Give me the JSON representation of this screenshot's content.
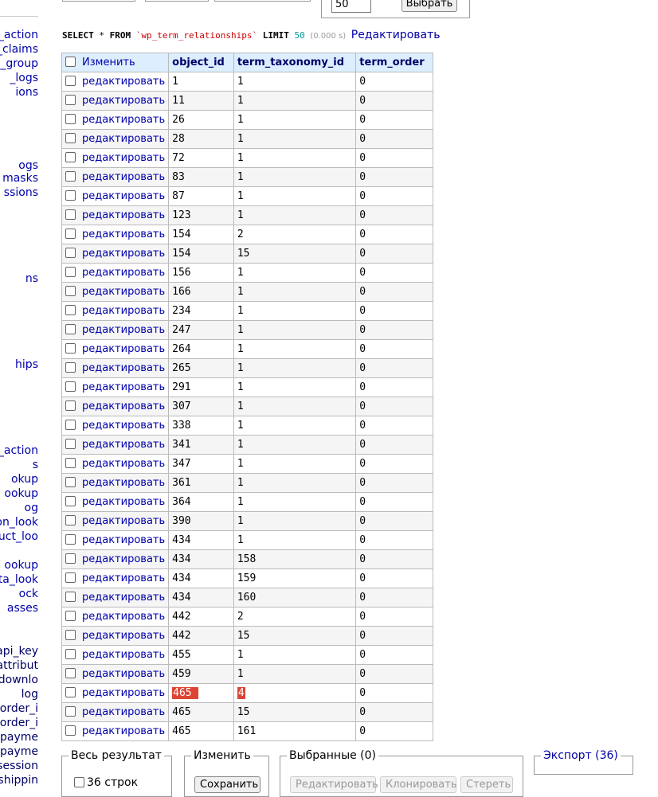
{
  "sidebar": {
    "items": [
      "_action",
      "_claims",
      "_group",
      "_logs",
      "ions",
      "ogs",
      "masks",
      "ssions",
      "ns",
      "hips",
      "_action",
      "s",
      "okup",
      "ookup",
      "og",
      "on_look",
      "uct_loo",
      "ookup",
      "ta_look",
      "ock",
      "asses",
      "api_key",
      "attribut",
      "downlo",
      "log",
      "order_i",
      "order_i",
      "payme",
      "payme",
      "session",
      "shippin"
    ]
  },
  "limit": {
    "value": "50",
    "button": "Выбрать"
  },
  "query": {
    "select": "SELECT",
    "star": "*",
    "from": "FROM",
    "table": "`wp_term_relationships`",
    "limit_kw": "LIMIT",
    "limit_num": "50",
    "time": "(0.000 s)",
    "edit_link": "Редактировать"
  },
  "table": {
    "headers": [
      "Изменить",
      "object_id",
      "term_taxonomy_id",
      "term_order"
    ],
    "edit_label": "редактировать",
    "rows": [
      [
        "1",
        "1",
        "0"
      ],
      [
        "11",
        "1",
        "0"
      ],
      [
        "26",
        "1",
        "0"
      ],
      [
        "28",
        "1",
        "0"
      ],
      [
        "72",
        "1",
        "0"
      ],
      [
        "83",
        "1",
        "0"
      ],
      [
        "87",
        "1",
        "0"
      ],
      [
        "123",
        "1",
        "0"
      ],
      [
        "154",
        "2",
        "0"
      ],
      [
        "154",
        "15",
        "0"
      ],
      [
        "156",
        "1",
        "0"
      ],
      [
        "166",
        "1",
        "0"
      ],
      [
        "234",
        "1",
        "0"
      ],
      [
        "247",
        "1",
        "0"
      ],
      [
        "264",
        "1",
        "0"
      ],
      [
        "265",
        "1",
        "0"
      ],
      [
        "291",
        "1",
        "0"
      ],
      [
        "307",
        "1",
        "0"
      ],
      [
        "338",
        "1",
        "0"
      ],
      [
        "341",
        "1",
        "0"
      ],
      [
        "347",
        "1",
        "0"
      ],
      [
        "361",
        "1",
        "0"
      ],
      [
        "364",
        "1",
        "0"
      ],
      [
        "390",
        "1",
        "0"
      ],
      [
        "434",
        "1",
        "0"
      ],
      [
        "434",
        "158",
        "0"
      ],
      [
        "434",
        "159",
        "0"
      ],
      [
        "434",
        "160",
        "0"
      ],
      [
        "442",
        "2",
        "0"
      ],
      [
        "442",
        "15",
        "0"
      ],
      [
        "455",
        "1",
        "0"
      ],
      [
        "459",
        "1",
        "0"
      ],
      [
        "465",
        "4",
        "0"
      ],
      [
        "465",
        "15",
        "0"
      ],
      [
        "465",
        "161",
        "0"
      ]
    ],
    "highlight_row": 32
  },
  "footer": {
    "whole_result": {
      "legend": "Весь результат",
      "rows_label": "36 строк"
    },
    "modify": {
      "legend": "Изменить",
      "save": "Сохранить"
    },
    "selected": {
      "legend": "Выбранные (0)",
      "edit": "Редактировать",
      "clone": "Клонировать",
      "delete": "Стереть"
    },
    "export": {
      "legend": "Экспорт (36)"
    }
  },
  "colors": {
    "link": "#0000aa",
    "header_bg": "#ddeeff",
    "highlight": "#dd4433"
  }
}
